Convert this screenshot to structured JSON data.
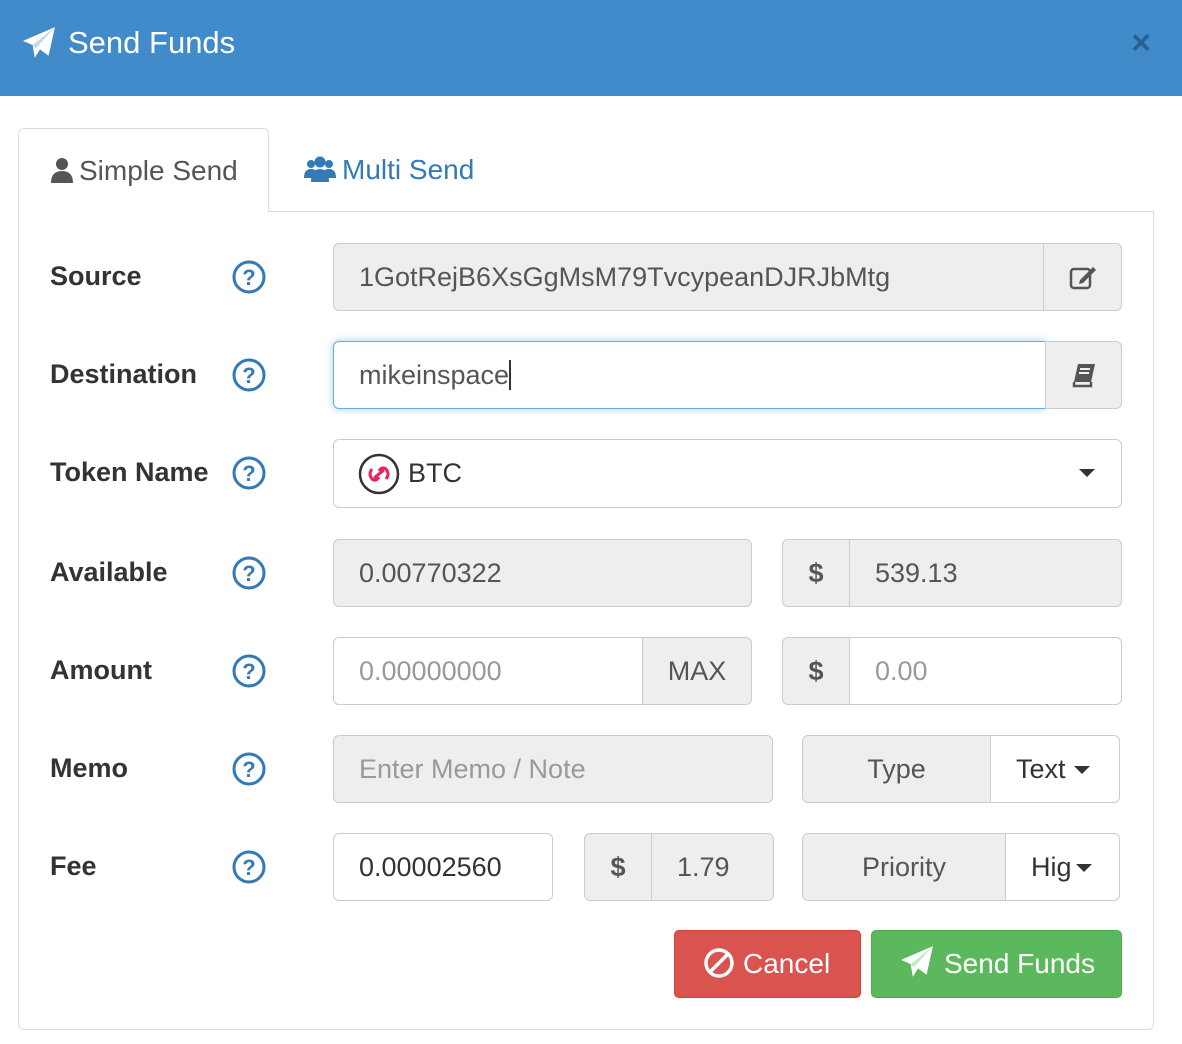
{
  "header": {
    "title": "Send Funds",
    "close_glyph": "×"
  },
  "tabs": [
    {
      "label": "Simple Send",
      "icon": "user-icon",
      "active": true
    },
    {
      "label": "Multi Send",
      "icon": "users-icon",
      "active": false
    }
  ],
  "form": {
    "source": {
      "label": "Source",
      "value": "1GotRejB6XsGgMsM79TvcypeanDJRJbMtg"
    },
    "destination": {
      "label": "Destination",
      "value": "mikeinspace"
    },
    "token": {
      "label": "Token Name",
      "value": "BTC"
    },
    "available": {
      "label": "Available",
      "value": "0.00770322",
      "currency_symbol": "$",
      "usd_value": "539.13"
    },
    "amount": {
      "label": "Amount",
      "placeholder": "0.00000000",
      "max_label": "MAX",
      "currency_symbol": "$",
      "usd_placeholder": "0.00"
    },
    "memo": {
      "label": "Memo",
      "placeholder": "Enter Memo / Note",
      "type_label": "Type",
      "type_value": "Text"
    },
    "fee": {
      "label": "Fee",
      "value": "0.00002560",
      "currency_symbol": "$",
      "usd_value": "1.79",
      "priority_label": "Priority",
      "priority_value": "Hig"
    }
  },
  "buttons": {
    "cancel": "Cancel",
    "send": "Send Funds"
  },
  "colors": {
    "header": "#418bca",
    "cancel": "#d9534f",
    "send": "#5cb85c",
    "link": "#337ab7"
  }
}
